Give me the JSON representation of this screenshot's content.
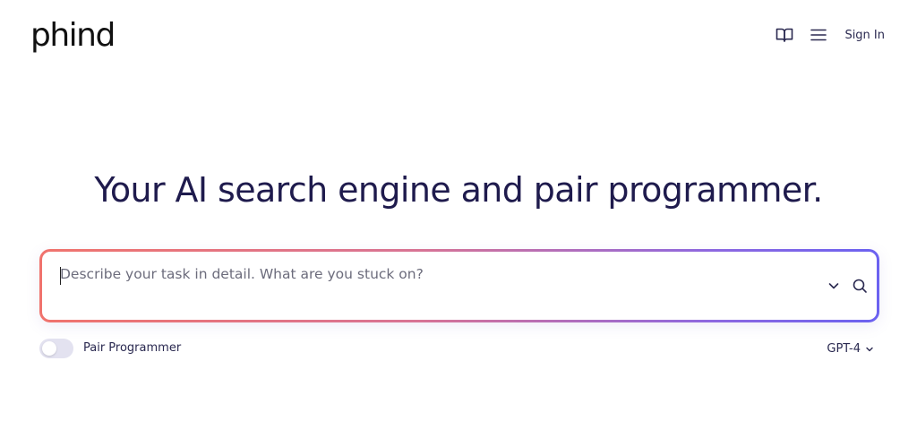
{
  "header": {
    "logo_text": "phind",
    "book_icon": "book-open-icon",
    "menu_icon": "hamburger-menu-icon",
    "signin_label": "Sign In"
  },
  "hero": {
    "headline": "Your AI search engine and pair programmer."
  },
  "search": {
    "placeholder": "Describe your task in detail. What are you stuck on?",
    "value": "",
    "expand_icon": "chevron-down-icon",
    "submit_icon": "search-icon",
    "border_gradient": [
      "#f0736d",
      "#d87394",
      "#8d68e0",
      "#6b62f0"
    ]
  },
  "options": {
    "pair_programmer_label": "Pair Programmer",
    "pair_programmer_enabled": false,
    "model_label": "GPT-4",
    "model_icon": "chevron-down-icon"
  },
  "colors": {
    "text_primary": "#1f1b4d",
    "toggle_track": "#e3e2f0"
  }
}
